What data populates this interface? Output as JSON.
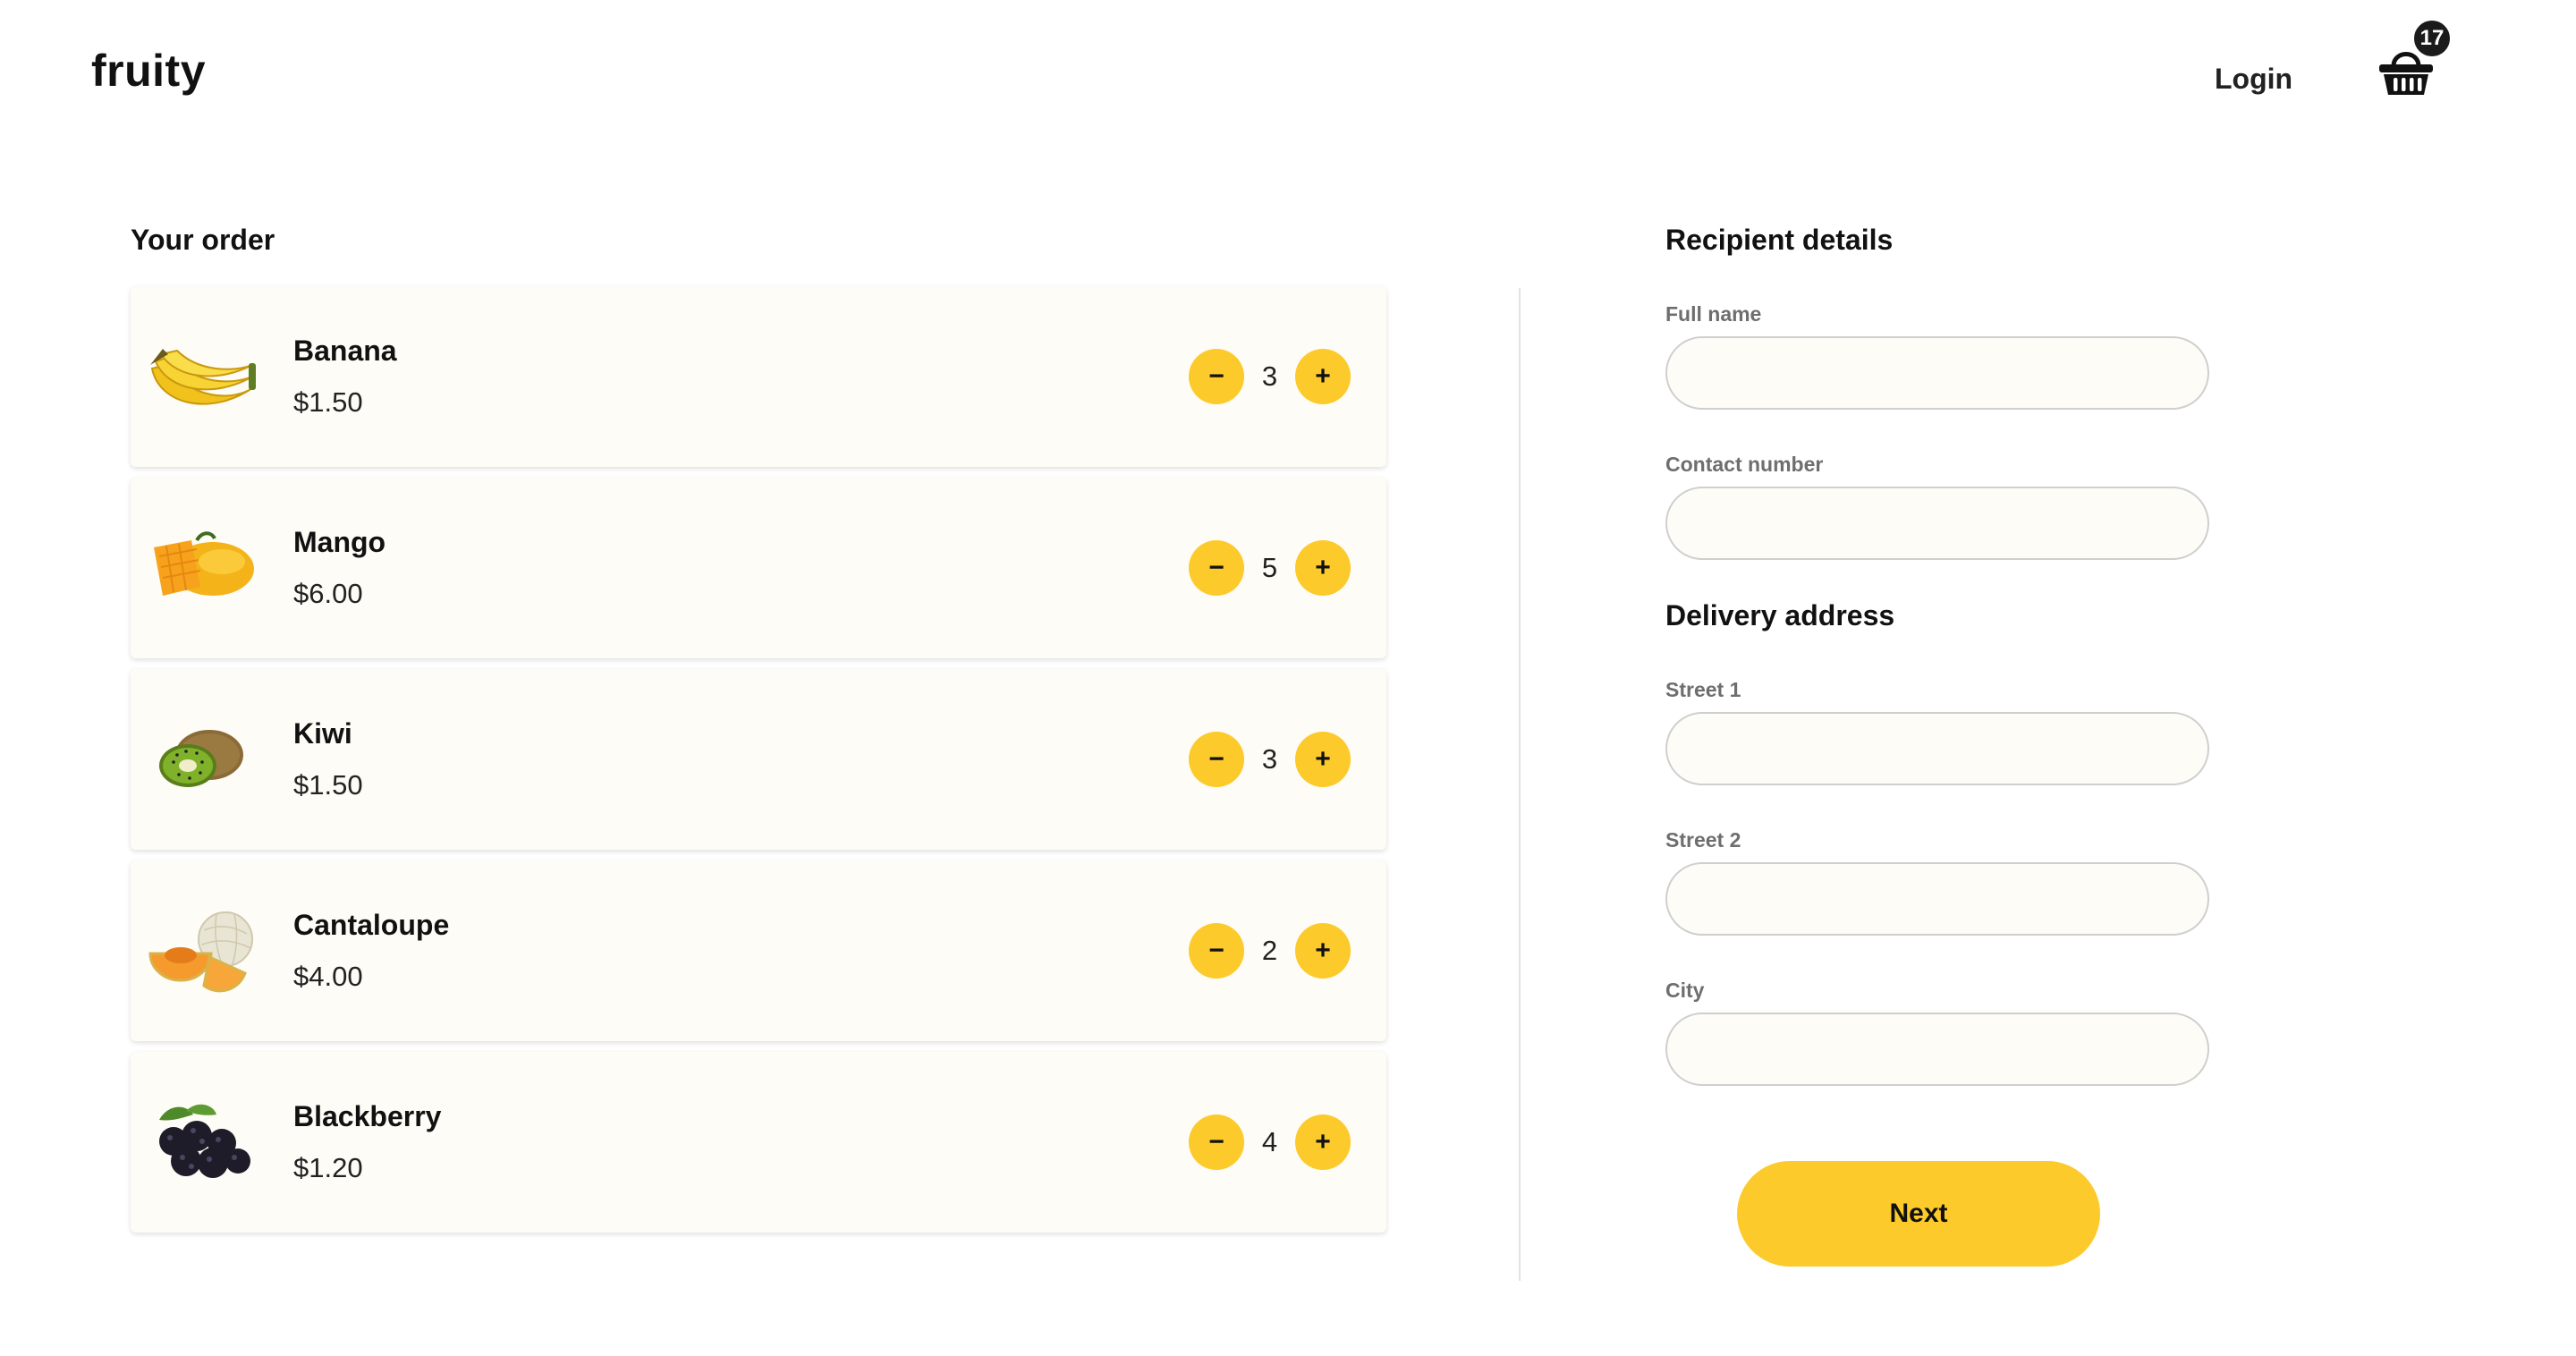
{
  "header": {
    "logo": "fruity",
    "login_label": "Login",
    "cart_count": "17",
    "cart_icon": "basket-icon"
  },
  "order": {
    "title": "Your order",
    "items": [
      {
        "name": "Banana",
        "price": "$1.50",
        "quantity": "3",
        "icon": "banana-icon"
      },
      {
        "name": "Mango",
        "price": "$6.00",
        "quantity": "5",
        "icon": "mango-icon"
      },
      {
        "name": "Kiwi",
        "price": "$1.50",
        "quantity": "3",
        "icon": "kiwi-icon"
      },
      {
        "name": "Cantaloupe",
        "price": "$4.00",
        "quantity": "2",
        "icon": "cantaloupe-icon"
      },
      {
        "name": "Blackberry",
        "price": "$1.20",
        "quantity": "4",
        "icon": "blackberry-icon"
      }
    ],
    "minus_symbol": "−",
    "plus_symbol": "+"
  },
  "recipient": {
    "title": "Recipient details",
    "full_name": {
      "label": "Full name",
      "value": ""
    },
    "contact_number": {
      "label": "Contact number",
      "value": ""
    }
  },
  "delivery": {
    "title": "Delivery address",
    "street1": {
      "label": "Street 1",
      "value": ""
    },
    "street2": {
      "label": "Street 2",
      "value": ""
    },
    "city": {
      "label": "City",
      "value": ""
    }
  },
  "next_label": "Next",
  "colors": {
    "accent": "#fdca2b",
    "card_background": "#fdfcf6",
    "badge": "#1b1b1b"
  }
}
